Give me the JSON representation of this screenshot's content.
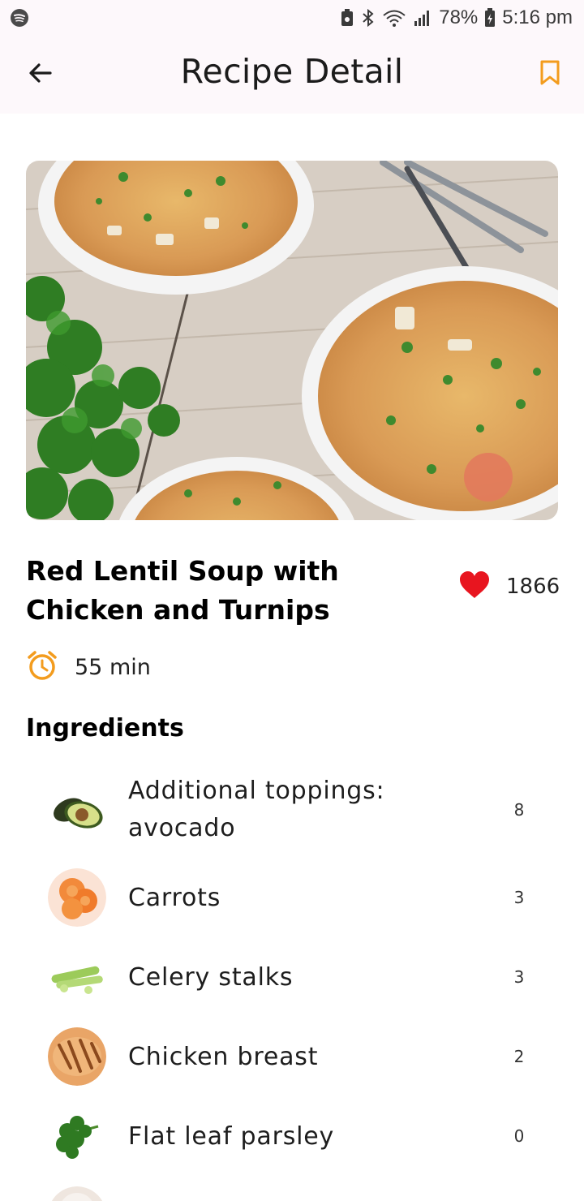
{
  "status_bar": {
    "battery": "78%",
    "time": "5:16 pm",
    "icons": [
      "spotify-icon",
      "battery-saver-icon",
      "bluetooth-icon",
      "wifi-icon",
      "signal-icon",
      "battery-icon"
    ]
  },
  "app_bar": {
    "title": "Recipe Detail",
    "back_icon": "arrow-back-icon",
    "bookmark_icon": "bookmark-outline-icon"
  },
  "recipe": {
    "title": "Red Lentil Soup with Chicken and Turnips",
    "likes": "1866",
    "time": "55 min"
  },
  "ingredients_section": {
    "title": "Ingredients",
    "items": [
      {
        "name": "Additional toppings: avocado",
        "qty": "8",
        "image": "avocado"
      },
      {
        "name": "Carrots",
        "qty": "3",
        "image": "carrots"
      },
      {
        "name": "Celery stalks",
        "qty": "3",
        "image": "celery"
      },
      {
        "name": "Chicken breast",
        "qty": "2",
        "image": "chicken"
      },
      {
        "name": "Flat leaf parsley",
        "qty": "0",
        "image": "parsley"
      }
    ]
  },
  "colors": {
    "accent": "#f39c1e",
    "heart": "#e8151f",
    "app_bar_bg": "#fdf8fb"
  }
}
